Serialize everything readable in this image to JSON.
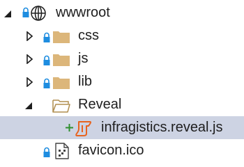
{
  "tree": {
    "root": {
      "label": "wwwroot",
      "icon": "globe-icon",
      "expanded": true,
      "checked_in": true
    },
    "items": [
      {
        "label": "css",
        "icon": "folder-icon",
        "expanded": false,
        "checked_in": true
      },
      {
        "label": "js",
        "icon": "folder-icon",
        "expanded": false,
        "checked_in": true
      },
      {
        "label": "lib",
        "icon": "folder-icon",
        "expanded": false,
        "checked_in": true
      },
      {
        "label": "Reveal",
        "icon": "folder-open-icon",
        "expanded": true,
        "checked_in": false,
        "children": [
          {
            "label": "infragistics.reveal.js",
            "icon": "javascript-file-icon",
            "status": "added",
            "selected": true
          }
        ]
      },
      {
        "label": "favicon.ico",
        "icon": "icon-file-icon",
        "checked_in": true
      }
    ]
  },
  "colors": {
    "lock": "#1e8de0",
    "folder": "#dcb67a",
    "js_file": "#e8631e",
    "added_plus": "#2f8f2f",
    "selection": "#cdd3e3",
    "text": "#1e1e1e"
  }
}
